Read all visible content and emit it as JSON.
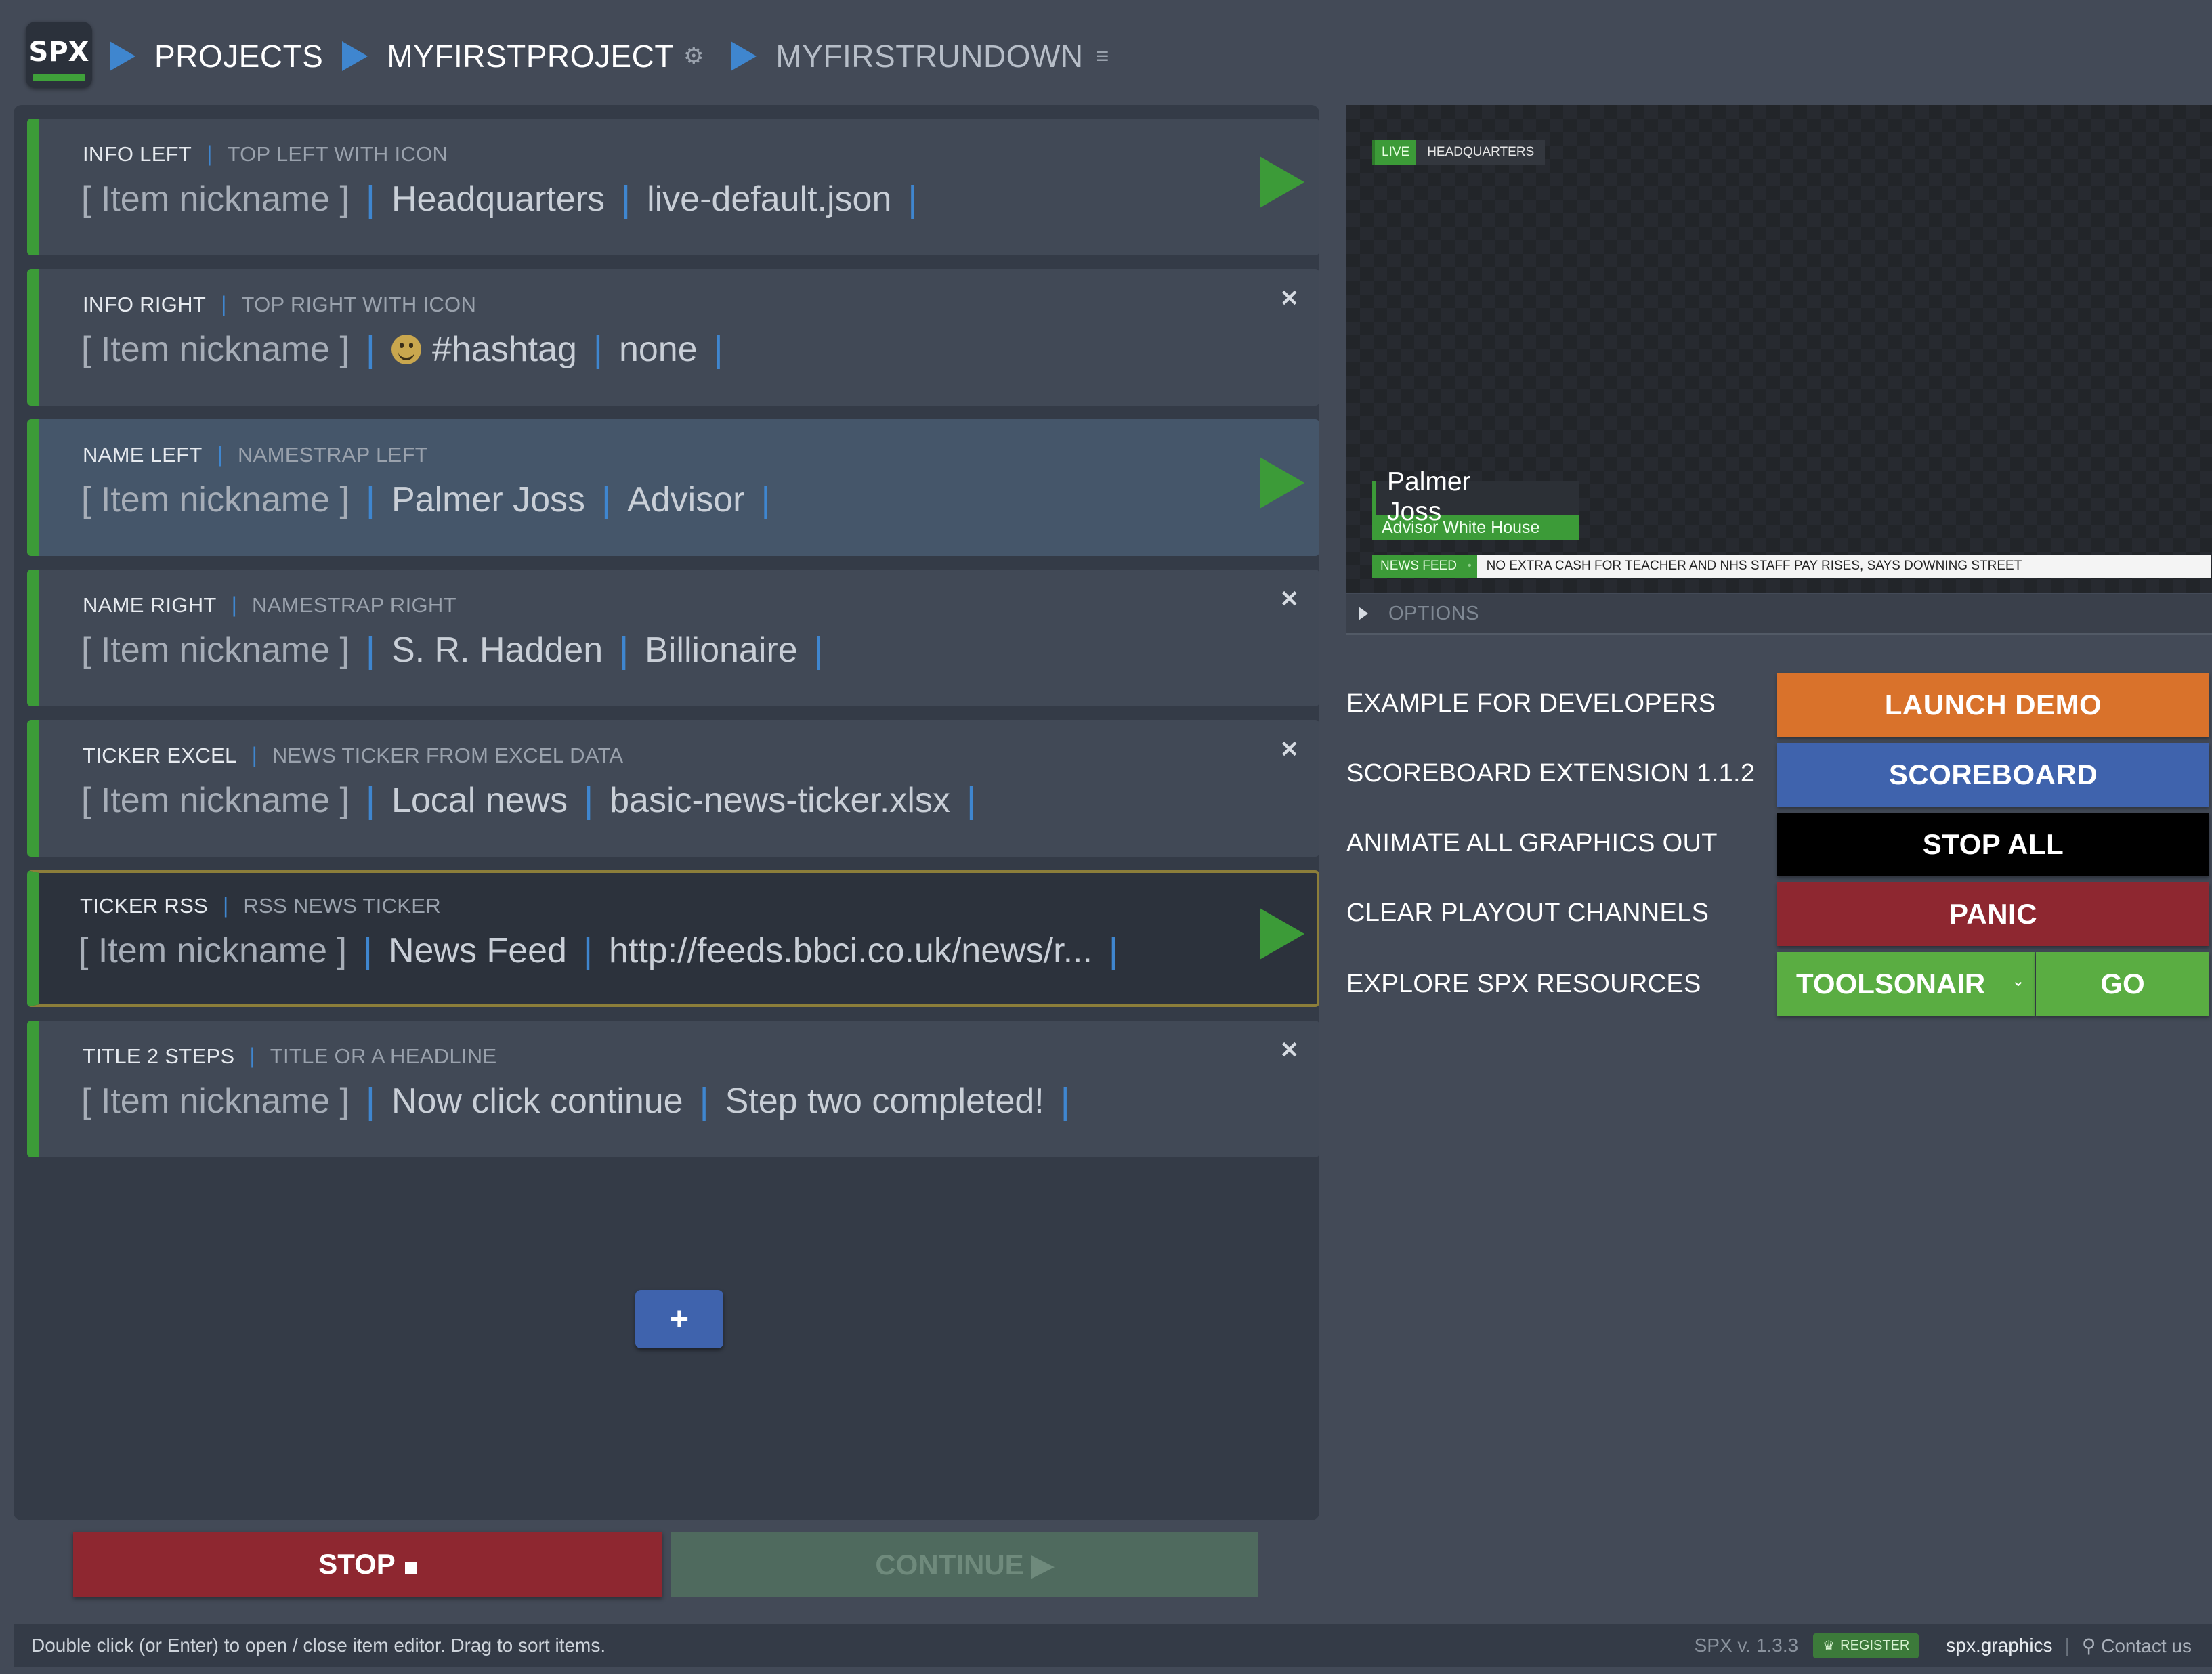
{
  "header": {
    "logo": "SPX",
    "breadcrumbs": [
      "PROJECTS",
      "MYFIRSTPROJECT",
      "MYFIRSTRUNDOWN"
    ],
    "project_icon": "gear-icon",
    "rundown_icon": "menu-icon"
  },
  "rundown": {
    "items": [
      {
        "template": "INFO LEFT",
        "description": "TOP LEFT WITH ICON",
        "nickname": "[ Item nickname ]",
        "field1": "Headquarters",
        "field2": "live-default.json",
        "state": "playing"
      },
      {
        "template": "INFO RIGHT",
        "description": "TOP RIGHT WITH ICON",
        "nickname": "[ Item nickname ]",
        "field1": "#hashtag",
        "field2": "none",
        "state": "stopped"
      },
      {
        "template": "NAME LEFT",
        "description": "NAMESTRAP LEFT",
        "nickname": "[ Item nickname ]",
        "field1": "Palmer Joss",
        "field2": "Advisor",
        "state": "playing"
      },
      {
        "template": "NAME RIGHT",
        "description": "NAMESTRAP RIGHT",
        "nickname": "[ Item nickname ]",
        "field1": "S. R. Hadden",
        "field2": "Billionaire",
        "state": "stopped"
      },
      {
        "template": "TICKER EXCEL",
        "description": "NEWS TICKER FROM EXCEL DATA",
        "nickname": "[ Item nickname ]",
        "field1": "Local news",
        "field2": "basic-news-ticker.xlsx",
        "state": "stopped"
      },
      {
        "template": "TICKER RSS",
        "description": "RSS NEWS TICKER",
        "nickname": "[ Item nickname ]",
        "field1": "News Feed",
        "field2": "http://feeds.bbci.co.uk/news/r...",
        "state": "playing"
      },
      {
        "template": "TITLE 2 STEPS",
        "description": "TITLE OR A HEADLINE",
        "nickname": "[ Item nickname ]",
        "field1": "Now click continue",
        "field2": "Step two completed!",
        "state": "stopped"
      }
    ],
    "add_button": "+"
  },
  "controls": {
    "stop": "STOP",
    "continue": "CONTINUE ▶"
  },
  "preview": {
    "live_label": "LIVE",
    "location": "HEADQUARTERS",
    "name": "Palmer Joss",
    "title": "Advisor  White House",
    "ticker_label": "NEWS FEED",
    "ticker_text": "NO EXTRA CASH FOR TEACHER AND NHS STAFF PAY RISES, SAYS DOWNING STREET",
    "options_label": "OPTIONS"
  },
  "actions": [
    {
      "label": "EXAMPLE FOR DEVELOPERS",
      "button": "LAUNCH DEMO",
      "color": "#d9722b"
    },
    {
      "label": "SCOREBOARD EXTENSION 1.1.2",
      "button": "SCOREBOARD",
      "color": "#3f63ad"
    },
    {
      "label": "ANIMATE ALL GRAPHICS OUT",
      "button": "STOP ALL",
      "color": "#000000"
    },
    {
      "label": "CLEAR PLAYOUT CHANNELS",
      "button": "PANIC",
      "color": "#8e2730"
    }
  ],
  "resources": {
    "label": "EXPLORE SPX RESOURCES",
    "selected": "TOOLSONAIR",
    "go": "GO"
  },
  "footer": {
    "hint": "Double click (or Enter) to open / close item editor. Drag to sort items.",
    "version": "SPX v. 1.3.3",
    "register": "REGISTER",
    "site": "spx.graphics",
    "contact": "Contact us"
  }
}
